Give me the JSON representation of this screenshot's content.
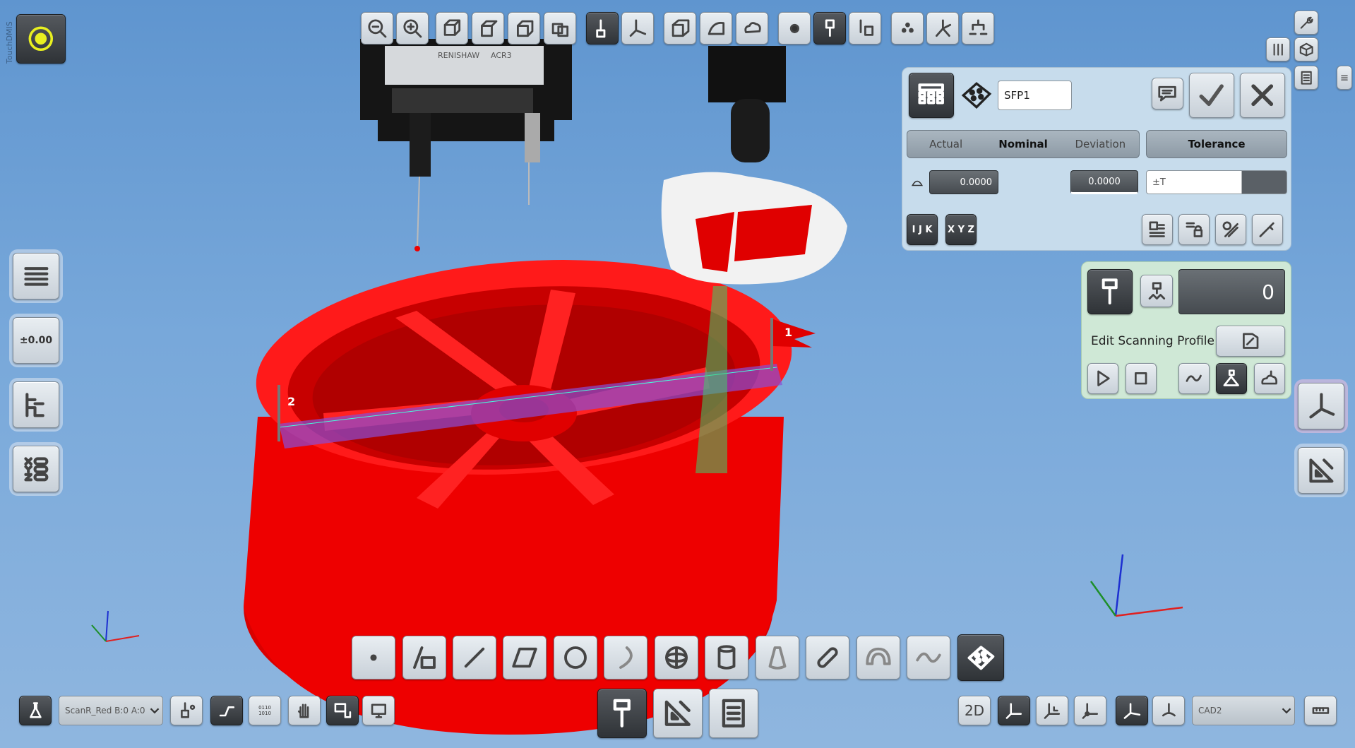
{
  "app": {
    "brand": "TouchDMIS"
  },
  "feature_panel": {
    "feature_name": "SFP1",
    "tabs": [
      "Actual",
      "Nominal",
      "Deviation"
    ],
    "active_tab": "Nominal",
    "tolerance_label": "Tolerance",
    "nominal_value": "0.0000",
    "deviation_value": "0.0000",
    "tolerance_value": "±T",
    "ijk_label": "I J K",
    "xyz_label": "X Y Z"
  },
  "scan_panel": {
    "counter": "0",
    "edit_profile_label": "Edit Scanning Profile"
  },
  "bottom_bar": {
    "probe_dropdown": "ScanR_Red B:0 A:0",
    "view_2d": "2D",
    "cad_dropdown": "CAD2",
    "binary_icon_text": "0110\n1010"
  },
  "side_toolbar": {
    "tolerance_button_text": "±0.00"
  },
  "scene": {
    "marker_1": "1",
    "marker_2": "2",
    "head_brand": "RENISHAW",
    "head_model": "ACR3"
  },
  "colors": {
    "part": "#ff0000",
    "scan_band": "#8a4bd6",
    "scan_panel_bg": "#cfe8d6",
    "feature_panel_bg": "#c7dcec"
  }
}
